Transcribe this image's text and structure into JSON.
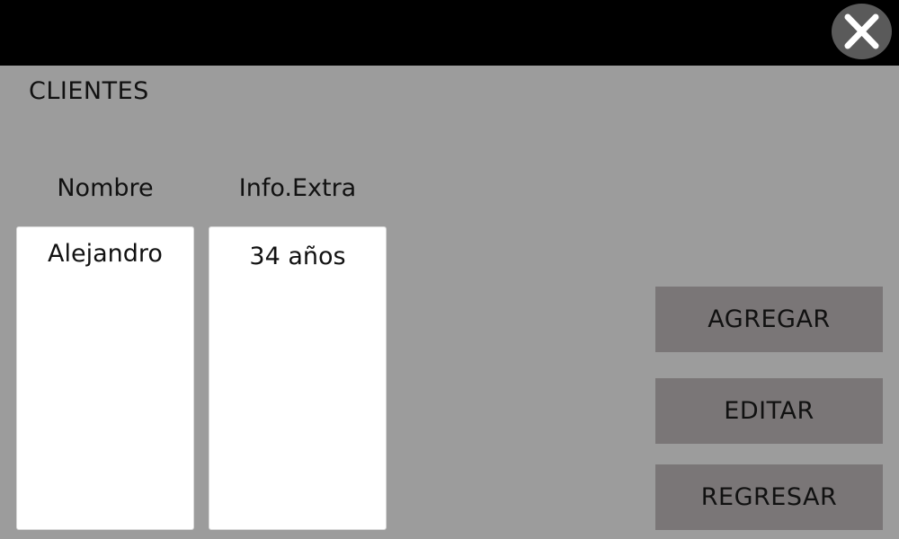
{
  "header": {
    "close_icon": "close-icon"
  },
  "page": {
    "title": "CLIENTES"
  },
  "table": {
    "columns": [
      "Nombre",
      "Info.Extra"
    ],
    "rows": [
      {
        "nombre": "Alejandro",
        "info_extra": "34 años"
      }
    ]
  },
  "actions": {
    "agregar": "AGREGAR",
    "editar": "EDITAR",
    "regresar": "REGRESAR"
  },
  "colors": {
    "background": "#9c9c9c",
    "topbar": "#000000",
    "button": "#7a7677",
    "list_background": "#ffffff",
    "close_button": "#5a5a5a"
  }
}
